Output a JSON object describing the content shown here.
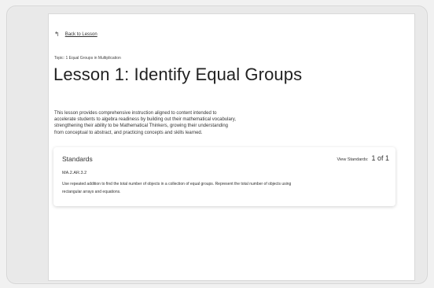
{
  "nav": {
    "back_label": "Back to Lesson"
  },
  "lesson": {
    "topic": "Topic: 1 Equal Groups in Multiplication",
    "title": "Lesson 1: Identify Equal Groups",
    "description_lines": [
      "This lesson provides comprehensive instruction aligned to content intended to",
      "accelerate students to algebra readiness by building out their mathematical vocabulary,",
      "strengthening their ability to be Mathematical Thinkers, growing their understanding",
      "from conceptual to abstract, and practicing concepts and skills learned."
    ]
  },
  "standards": {
    "heading": "Standards",
    "view_label": "View Standards:",
    "count": "1 of 1",
    "code": "MA.2.AR.3.2",
    "text_lines": [
      "Use repeated addition to find the total number of objects in a collection of equal groups. Represent the total number of objects using",
      "rectangular arrays and equations."
    ]
  }
}
